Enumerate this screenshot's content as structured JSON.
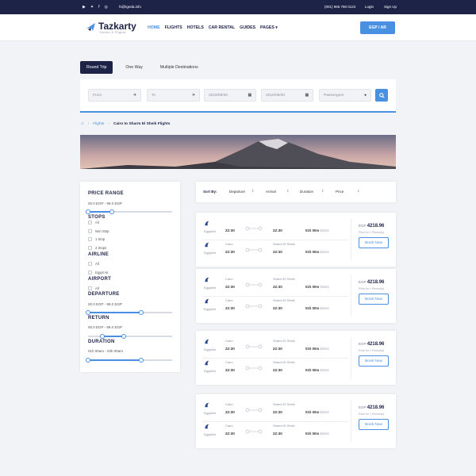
{
  "topbar": {
    "email": "hi@tgeda.info",
    "phone": "(001) 966 780 0123",
    "login": "Login",
    "signup": "Sign Up",
    "social": [
      "youtube-icon",
      "twitter-icon",
      "facebook-icon",
      "instagram-icon"
    ]
  },
  "brand": {
    "name": "Tazkarty",
    "tagline": "Hotels & Flights"
  },
  "nav": [
    "HOME",
    "FLIGHTS",
    "HOTELS",
    "CAR RENTAL",
    "GUIDES",
    "PAGES"
  ],
  "currency_button": "EGP / AR",
  "search_tabs": [
    "Round Trip",
    "One Way",
    "Multiple Destinations"
  ],
  "search": {
    "from": "From",
    "to": "To",
    "depart_date": "2019/09/30",
    "return_date": "2019/09/30",
    "passengers": "Passengers"
  },
  "breadcrumb": {
    "link": "Flights",
    "current": "Cairo to Sharm El Sheik Flights"
  },
  "filters": {
    "price_range": {
      "title": "PRICE RANGE",
      "value": "00.0 EGP - 99.0 EGP",
      "low": 0.0,
      "high": 0.28
    },
    "stops": {
      "title": "STOPS",
      "options": [
        "All",
        "Non Stop",
        "1 Stop",
        "2 Stops"
      ]
    },
    "airline": {
      "title": "AIRLINE",
      "options": [
        "All",
        "Egypt Air"
      ]
    },
    "airport": {
      "title": "AIRPORT",
      "options": [
        "All"
      ]
    },
    "departure": {
      "title": "DEPARTURE",
      "value": "00.0 EGP - 99.0 EGP",
      "low": 0.0,
      "high": 0.63
    },
    "return": {
      "title": "RETURN",
      "value": "00.0 EGP - 99.0 EGP",
      "low": 0.17,
      "high": 0.43
    },
    "duration": {
      "title": "DURATION",
      "value": "01h 00am - 03h 00am",
      "low": 0.0,
      "high": 0.63
    }
  },
  "sort": {
    "label": "Sort By:",
    "options": [
      "Departure",
      "Arrival",
      "Duration",
      "Price"
    ]
  },
  "flights": [
    {
      "legs": [
        {
          "airline": "EgyptAir",
          "from_city": "",
          "to_city": "",
          "dep": "22:30",
          "arr": "22:30",
          "dur": "01h 00m",
          "stops": "Direct"
        },
        {
          "airline": "EgyptAir",
          "from_city": "Cairo",
          "to_city": "Sharm El Sheik",
          "dep": "22:30",
          "arr": "22:30",
          "dur": "01h 00m",
          "stops": "Direct"
        }
      ],
      "price_currency": "EGP",
      "price": "4218.96",
      "price_note": "Price for 1 Person(s)",
      "book": "Book Now"
    },
    {
      "legs": [
        {
          "airline": "EgyptAir",
          "from_city": "Cairo",
          "to_city": "Sharm El Sheik",
          "dep": "22:30",
          "arr": "22:30",
          "dur": "01h 00m",
          "stops": "Direct"
        },
        {
          "airline": "EgyptAir",
          "from_city": "Cairo",
          "to_city": "Sharm El Sheik",
          "dep": "22:30",
          "arr": "22:30",
          "dur": "01h 00m",
          "stops": "Direct"
        }
      ],
      "price_currency": "EGP",
      "price": "4218.96",
      "price_note": "Price for 1 Person(s)",
      "book": "Book Now"
    },
    {
      "legs": [
        {
          "airline": "EgyptAir",
          "from_city": "Cairo",
          "to_city": "Sharm El Sheik",
          "dep": "22:30",
          "arr": "22:30",
          "dur": "01h 00m",
          "stops": "Direct"
        },
        {
          "airline": "EgyptAir",
          "from_city": "Cairo",
          "to_city": "Sharm El Sheik",
          "dep": "22:30",
          "arr": "22:30",
          "dur": "01h 00m",
          "stops": "Direct"
        }
      ],
      "price_currency": "EGP",
      "price": "4218.96",
      "price_note": "Price for 1 Person(s)",
      "book": "Book Now"
    },
    {
      "legs": [
        {
          "airline": "EgyptAir",
          "from_city": "Cairo",
          "to_city": "Sharm El Sheik",
          "dep": "22:30",
          "arr": "22:30",
          "dur": "01h 00m",
          "stops": "Direct"
        },
        {
          "airline": "EgyptAir",
          "from_city": "Cairo",
          "to_city": "Sharm El Sheik",
          "dep": "22:30",
          "arr": "22:30",
          "dur": "01h 00m",
          "stops": "Direct"
        }
      ],
      "price_currency": "EGP",
      "price": "4218.96",
      "price_note": "Price for 1 Person(s)",
      "book": "Book Now"
    }
  ],
  "colors": {
    "navy": "#1d2247",
    "accent": "#4a90e2",
    "background": "#f2f3f6"
  }
}
